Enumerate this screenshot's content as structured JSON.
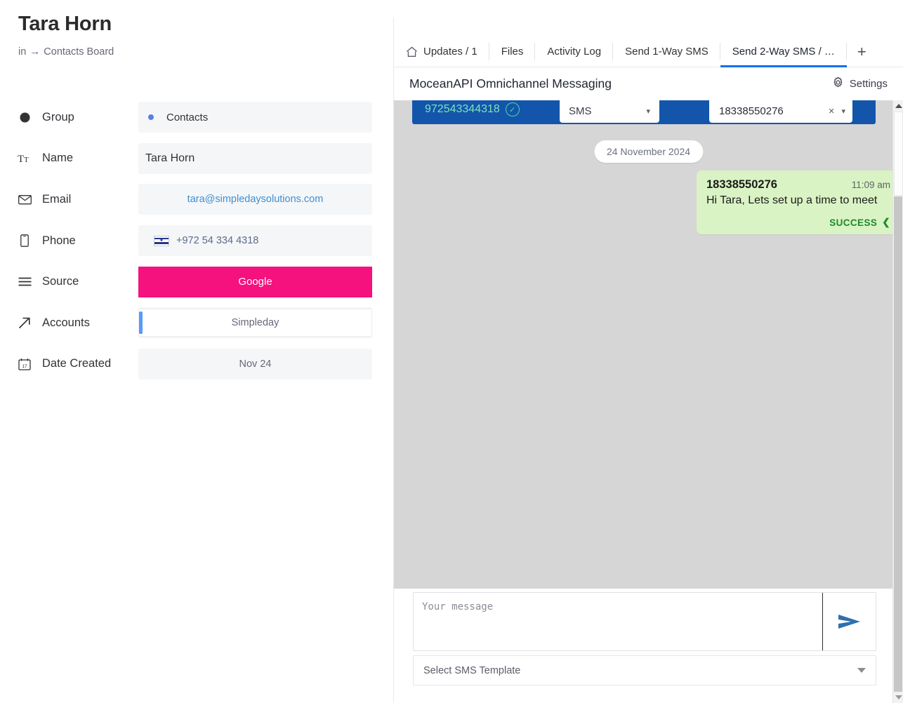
{
  "window": {
    "close_label": "×"
  },
  "item": {
    "title": "Tara Horn",
    "breadcrumb_in": "in",
    "breadcrumb_arrow": "→",
    "breadcrumb_board": "Contacts Board"
  },
  "fields": [
    {
      "label": "Group",
      "icon": "circle-icon",
      "value": "Contacts"
    },
    {
      "label": "Name",
      "icon": "text-format-icon",
      "value": "Tara Horn"
    },
    {
      "label": "Email",
      "icon": "envelope-icon",
      "value": "tara@simpledaysolutions.com"
    },
    {
      "label": "Phone",
      "icon": "phone-icon",
      "value": "+972 54 334 4318"
    },
    {
      "label": "Source",
      "icon": "list-icon",
      "value": "Google"
    },
    {
      "label": "Accounts",
      "icon": "arrow-up-right-icon",
      "value": "Simpleday"
    },
    {
      "label": "Date Created",
      "icon": "calendar-icon",
      "value": "Nov 24"
    }
  ],
  "colors": {
    "source_chip": "#f5117e",
    "accounts_bar": "#579bfc",
    "group_dot": "#5b7fe3",
    "tab_active_underline": "#0073ea",
    "recipient_bar": "#1355ab",
    "bubble": "#d9f3c4",
    "success": "#1d8a2b",
    "email_link": "#3d8fd4"
  },
  "tabs": [
    {
      "label": "Updates / 1",
      "icon": "home-icon",
      "active": false
    },
    {
      "label": "Files",
      "icon": "",
      "active": false
    },
    {
      "label": "Activity Log",
      "icon": "",
      "active": false
    },
    {
      "label": "Send 1-Way SMS",
      "icon": "",
      "active": false
    },
    {
      "label": "Send 2-Way SMS / …",
      "icon": "",
      "active": true
    }
  ],
  "tab_add_label": "+",
  "app": {
    "title": "MoceanAPI Omnichannel Messaging",
    "settings_label": "Settings"
  },
  "conversation": {
    "recipient_phone": "972543344318",
    "channel_selected": "SMS",
    "sender_selected": "18338550276",
    "clear_label": "×",
    "date_divider": "24 November 2024",
    "messages": [
      {
        "sender": "18338550276",
        "time": "11:09 am",
        "text": "Hi Tara, Lets set up a time to meet",
        "status": "SUCCESS"
      }
    ]
  },
  "composer": {
    "placeholder": "Your message",
    "value": "",
    "template_placeholder": "Select SMS Template"
  }
}
